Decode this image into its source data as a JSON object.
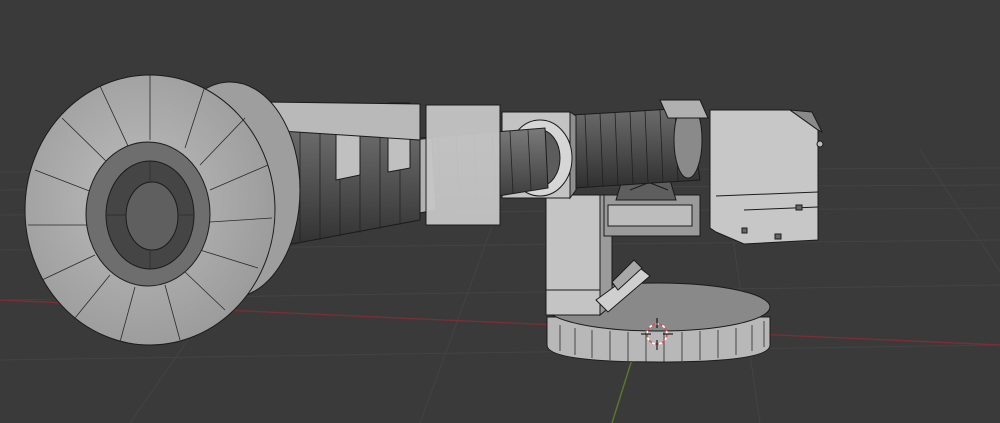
{
  "viewport": {
    "background": "#3b3b3b",
    "grid_color": "#424242",
    "x_axis_color": "#7a2e35",
    "y_axis_color": "#5a7a2a",
    "mesh_face": "#8f8f8f",
    "mesh_face_light": "#b5b5b5",
    "mesh_face_dark": "#4a4a4a",
    "wire_color": "#1b1b1b",
    "cursor_color": "#e05050",
    "cursor_icon": "3d-cursor-icon"
  },
  "scene": {
    "object": "turret-gun-mesh",
    "parts": [
      "muzzle-flare",
      "barrel",
      "barrel-clamp",
      "rear-barrel",
      "receiver-housing",
      "pivot-mount",
      "pedestal",
      "base-disc"
    ]
  }
}
